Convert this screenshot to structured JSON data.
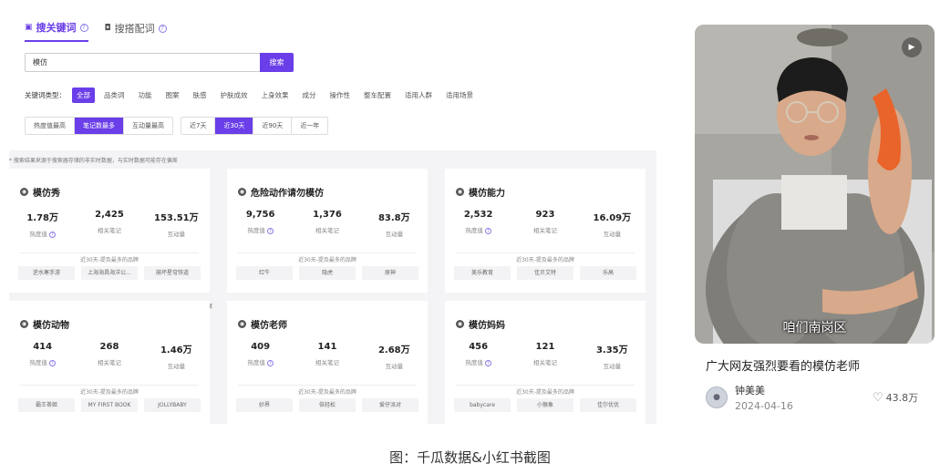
{
  "tabs": [
    {
      "label": "搜关键词",
      "active": true,
      "icon": "chat-icon"
    },
    {
      "label": "搜搭配词",
      "active": false,
      "icon": "tag-icon"
    }
  ],
  "search": {
    "value": "模仿",
    "button": "搜索"
  },
  "type_filter": {
    "label": "关键词类型：",
    "options": [
      "全部",
      "品类词",
      "功能",
      "图案",
      "肤感",
      "护肤成效",
      "上身效果",
      "成分",
      "操作性",
      "整车配置",
      "适用人群",
      "适用场景"
    ],
    "active": "全部"
  },
  "sort_options": {
    "options": [
      "热度值最高",
      "笔记数最多",
      "互动量最高"
    ],
    "active": "笔记数最多"
  },
  "time_options": {
    "options": [
      "近7天",
      "近30天",
      "近90天",
      "近一年"
    ],
    "active": "近30天"
  },
  "notice": "* 搜索结果来源于搜索器存储的非实时数据，与实时数据可能存在偏差",
  "tag_small": "图案",
  "metric_labels": {
    "heat": "热度值",
    "notes": "相关笔记",
    "interact": "互动量"
  },
  "brand_header": "近30天-提及最多的品牌",
  "cards": [
    {
      "title": "模仿秀",
      "heat": "1.78万",
      "notes": "2,425",
      "interact": "153.51万",
      "brands": [
        "逆水寒手游",
        "上海海昌海洋公...",
        "崩坏星穹铁道"
      ]
    },
    {
      "title": "危险动作请勿模仿",
      "heat": "9,756",
      "notes": "1,376",
      "interact": "83.8万",
      "brands": [
        "红牛",
        "隐虎",
        "原神"
      ]
    },
    {
      "title": "模仿能力",
      "heat": "2,532",
      "notes": "923",
      "interact": "16.09万",
      "brands": [
        "美乐教育",
        "佳贝艾特",
        "乐高"
      ]
    },
    {
      "title": "模仿动物",
      "heat": "414",
      "notes": "268",
      "interact": "1.46万",
      "brands": [
        "霸王茶姬",
        "MY FIRST BOOK",
        "JOLLYBABY"
      ]
    },
    {
      "title": "模仿老师",
      "heat": "409",
      "notes": "141",
      "interact": "2.68万",
      "brands": [
        "妙界",
        "倍轻松",
        "爱仔派对"
      ]
    },
    {
      "title": "模仿妈妈",
      "heat": "456",
      "notes": "121",
      "interact": "3.35万",
      "brands": [
        "babycare",
        "小猴象",
        "佳尔优优"
      ]
    }
  ],
  "post": {
    "subtitle": "咱们南岗区",
    "title": "广大网友强烈要看的模仿老师",
    "author": "钟美美",
    "date": "2024-04-16",
    "likes": "43.8万"
  },
  "caption": "图：千瓜数据&小红书截图",
  "colors": {
    "accent": "#6a3ee8"
  }
}
